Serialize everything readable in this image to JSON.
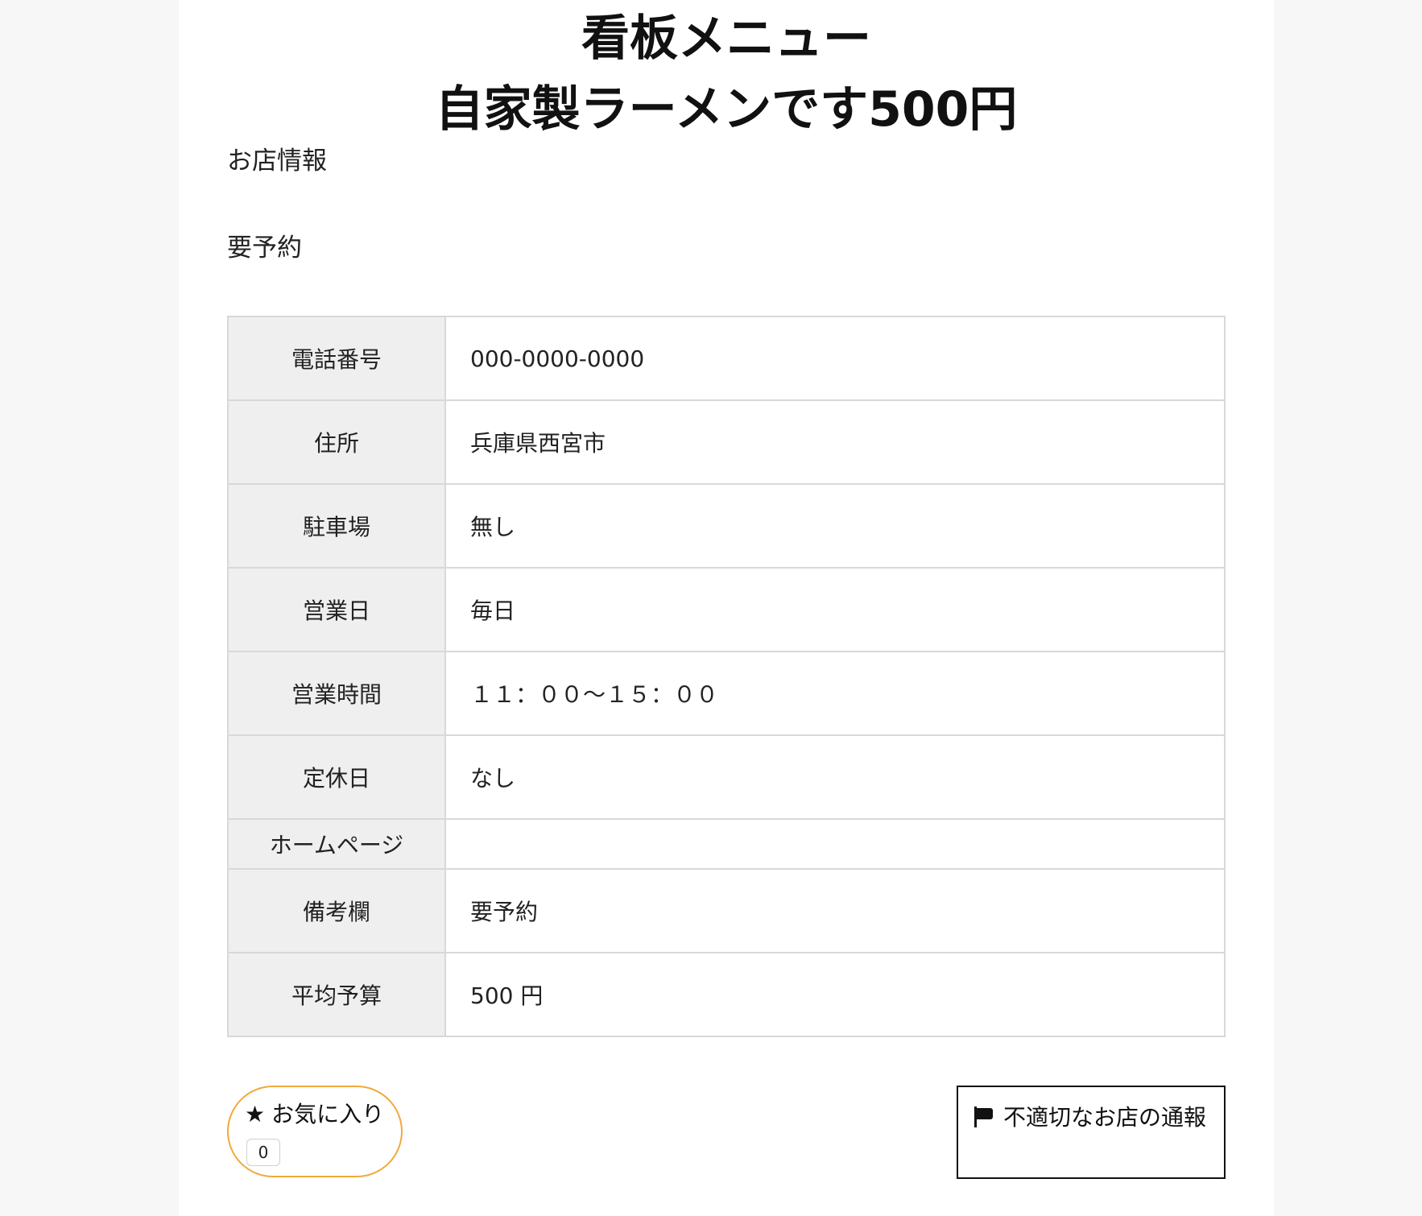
{
  "header": {
    "title_line1": "看板メニュー",
    "title_line2": "自家製ラーメンです500円"
  },
  "shop_info": {
    "heading": "お店情報",
    "notice": "要予約"
  },
  "table": {
    "rows": [
      {
        "label": "電話番号",
        "value": "000-0000-0000"
      },
      {
        "label": "住所",
        "value": "兵庫県西宮市"
      },
      {
        "label": "駐車場",
        "value": "無し"
      },
      {
        "label": "営業日",
        "value": "毎日"
      },
      {
        "label": "営業時間",
        "value": "１１：００〜１５：００"
      },
      {
        "label": "定休日",
        "value": "なし"
      },
      {
        "label": "ホームページ",
        "value": ""
      },
      {
        "label": "備考欄",
        "value": "要予約"
      },
      {
        "label": "平均予算",
        "value": "500 円"
      }
    ]
  },
  "actions": {
    "favorite_star": "★",
    "favorite_label": "お気に入り",
    "favorite_count": "0",
    "report_label": "不適切なお店の通報"
  },
  "colors": {
    "favorite_border": "#f2a93b",
    "label_cell_bg": "#efefef",
    "table_border": "#d8d8d8"
  },
  "icons": {
    "favorite": "star-icon",
    "report": "flag-icon"
  }
}
